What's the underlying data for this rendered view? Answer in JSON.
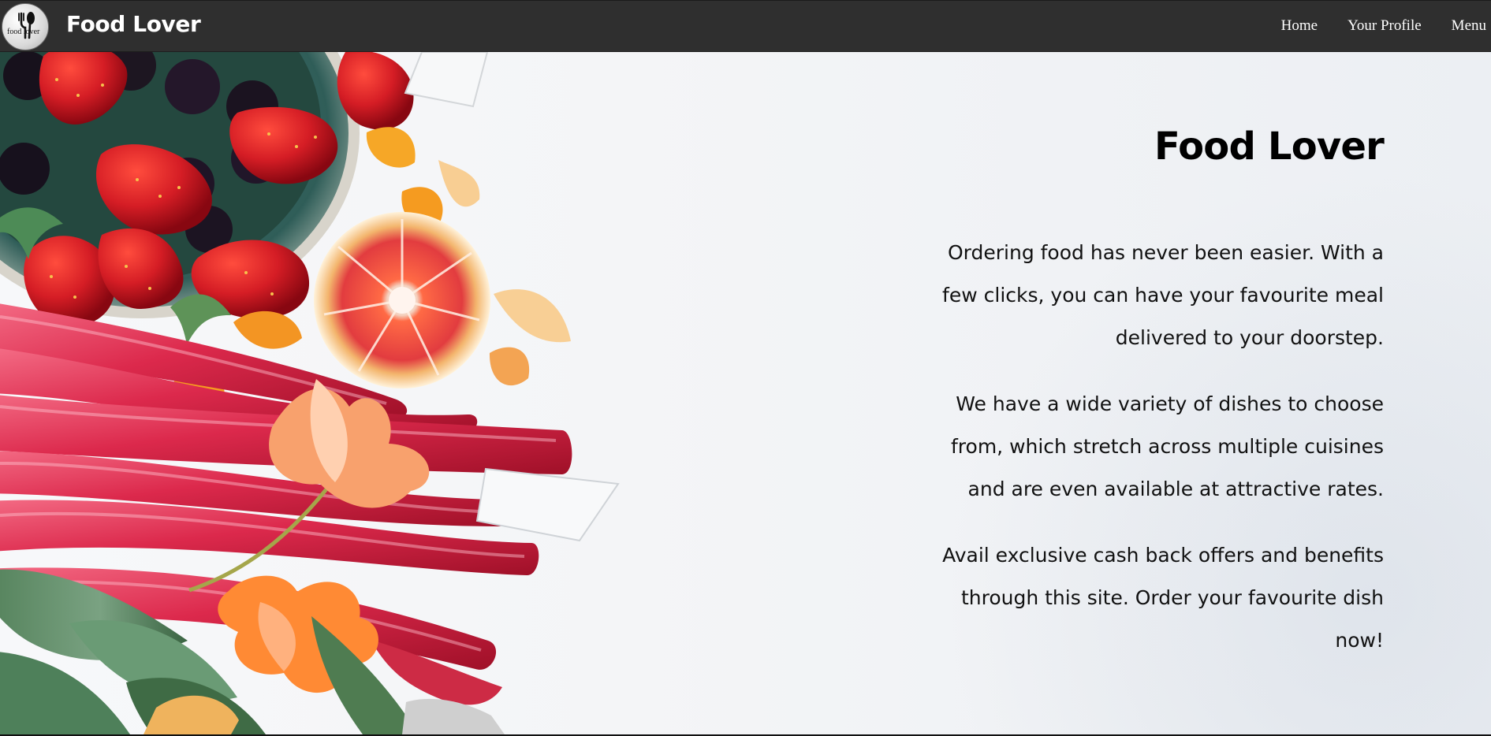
{
  "app": {
    "brand": "Food Lover",
    "logo_text": "food lover"
  },
  "navigation": {
    "items": [
      {
        "label": "Home"
      },
      {
        "label": "Your Profile"
      },
      {
        "label": "Menu"
      }
    ]
  },
  "hero": {
    "title": "Food Lover",
    "paragraphs": [
      "Ordering food has never been easier. With a few clicks, you can have your favourite meal delivered to your doorstep.",
      "We have a wide variety of dishes to choose from, which stretch across multiple cuisines and are even available at attractive rates.",
      "Avail exclusive cash back offers and benefits through this site. Order your favourite dish now!"
    ]
  },
  "icons": {
    "logo": "fork-spoon-logo-icon"
  },
  "colors": {
    "navbar": "#2f2f2f",
    "text_primary": "#000000",
    "background": "#f4f5f7"
  }
}
